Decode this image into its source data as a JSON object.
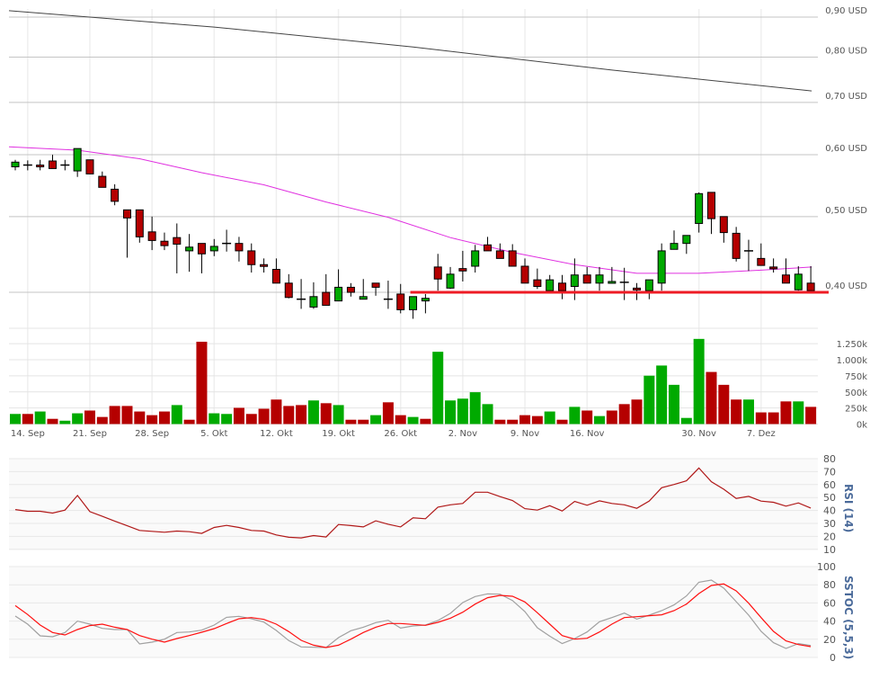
{
  "chart_data": [
    {
      "type": "candlestick",
      "panel": "price",
      "y_scale": "log",
      "ylim": [
        0.365,
        0.92
      ],
      "currency": "USD",
      "y_ticks": [
        {
          "value": 0.9,
          "label": "0,90 USD"
        },
        {
          "value": 0.8,
          "label": "0,80 USD"
        },
        {
          "value": 0.7,
          "label": "0,70 USD"
        },
        {
          "value": 0.6,
          "label": "0,60 USD"
        },
        {
          "value": 0.5,
          "label": "0,50 USD"
        },
        {
          "value": 0.4,
          "label": "0,40 USD"
        }
      ],
      "grid": true,
      "colors": {
        "up": "#00aa00",
        "down": "#b50000",
        "ma_short": "#e030e0",
        "ma_long": "#444444",
        "support": "#ee1c25"
      },
      "ohlc": [
        [
          0.579,
          0.591,
          0.573,
          0.587
        ],
        [
          0.582,
          0.59,
          0.573,
          0.582
        ],
        [
          0.582,
          0.591,
          0.573,
          0.58
        ],
        [
          0.589,
          0.6,
          0.576,
          0.576
        ],
        [
          0.582,
          0.591,
          0.573,
          0.582
        ],
        [
          0.572,
          0.611,
          0.562,
          0.611
        ],
        [
          0.591,
          0.591,
          0.567,
          0.567
        ],
        [
          0.563,
          0.571,
          0.545,
          0.545
        ],
        [
          0.542,
          0.55,
          0.517,
          0.523
        ],
        [
          0.51,
          0.51,
          0.443,
          0.498
        ],
        [
          0.51,
          0.51,
          0.463,
          0.471
        ],
        [
          0.478,
          0.5,
          0.453,
          0.466
        ],
        [
          0.465,
          0.477,
          0.453,
          0.459
        ],
        [
          0.47,
          0.49,
          0.423,
          0.461
        ],
        [
          0.452,
          0.475,
          0.425,
          0.457
        ],
        [
          0.462,
          0.462,
          0.423,
          0.448
        ],
        [
          0.452,
          0.468,
          0.445,
          0.458
        ],
        [
          0.462,
          0.481,
          0.451,
          0.462
        ],
        [
          0.462,
          0.471,
          0.438,
          0.452
        ],
        [
          0.452,
          0.462,
          0.424,
          0.434
        ],
        [
          0.434,
          0.442,
          0.424,
          0.432
        ],
        [
          0.428,
          0.442,
          0.411,
          0.411
        ],
        [
          0.411,
          0.422,
          0.393,
          0.394
        ],
        [
          0.392,
          0.416,
          0.381,
          0.391
        ],
        [
          0.383,
          0.412,
          0.381,
          0.395
        ],
        [
          0.4,
          0.422,
          0.385,
          0.385
        ],
        [
          0.39,
          0.428,
          0.39,
          0.406
        ],
        [
          0.406,
          0.411,
          0.395,
          0.4
        ],
        [
          0.392,
          0.416,
          0.392,
          0.395
        ],
        [
          0.411,
          0.411,
          0.396,
          0.406
        ],
        [
          0.392,
          0.414,
          0.381,
          0.391
        ],
        [
          0.398,
          0.41,
          0.376,
          0.38
        ],
        [
          0.38,
          0.395,
          0.37,
          0.395
        ],
        [
          0.39,
          0.398,
          0.376,
          0.393
        ],
        [
          0.431,
          0.448,
          0.402,
          0.416
        ],
        [
          0.405,
          0.431,
          0.404,
          0.422
        ],
        [
          0.429,
          0.452,
          0.413,
          0.426
        ],
        [
          0.432,
          0.46,
          0.424,
          0.452
        ],
        [
          0.46,
          0.471,
          0.452,
          0.452
        ],
        [
          0.452,
          0.462,
          0.442,
          0.442
        ],
        [
          0.452,
          0.461,
          0.432,
          0.432
        ],
        [
          0.432,
          0.442,
          0.411,
          0.411
        ],
        [
          0.415,
          0.429,
          0.404,
          0.407
        ],
        [
          0.402,
          0.421,
          0.402,
          0.415
        ],
        [
          0.411,
          0.421,
          0.392,
          0.402
        ],
        [
          0.407,
          0.442,
          0.391,
          0.421
        ],
        [
          0.421,
          0.431,
          0.411,
          0.411
        ],
        [
          0.411,
          0.431,
          0.402,
          0.421
        ],
        [
          0.411,
          0.431,
          0.411,
          0.413
        ],
        [
          0.412,
          0.43,
          0.391,
          0.412
        ],
        [
          0.405,
          0.411,
          0.391,
          0.403
        ],
        [
          0.402,
          0.415,
          0.392,
          0.415
        ],
        [
          0.411,
          0.462,
          0.402,
          0.452
        ],
        [
          0.454,
          0.48,
          0.454,
          0.462
        ],
        [
          0.462,
          0.473,
          0.448,
          0.473
        ],
        [
          0.49,
          0.537,
          0.477,
          0.535
        ],
        [
          0.537,
          0.537,
          0.475,
          0.497
        ],
        [
          0.5,
          0.5,
          0.463,
          0.477
        ],
        [
          0.476,
          0.485,
          0.438,
          0.442
        ],
        [
          0.452,
          0.467,
          0.426,
          0.452
        ],
        [
          0.442,
          0.462,
          0.433,
          0.433
        ],
        [
          0.431,
          0.442,
          0.424,
          0.429
        ],
        [
          0.421,
          0.442,
          0.411,
          0.411
        ],
        [
          0.403,
          0.432,
          0.402,
          0.422
        ],
        [
          0.411,
          0.432,
          0.402,
          0.402
        ]
      ],
      "ma_short": [
        [
          0,
          0.614
        ],
        [
          5,
          0.608
        ],
        [
          10,
          0.593
        ],
        [
          15,
          0.569
        ],
        [
          20,
          0.549
        ],
        [
          25,
          0.522
        ],
        [
          30,
          0.499
        ],
        [
          35,
          0.47
        ],
        [
          40,
          0.45
        ],
        [
          45,
          0.434
        ],
        [
          50,
          0.423
        ],
        [
          55,
          0.423
        ],
        [
          60,
          0.427
        ],
        [
          64,
          0.431
        ]
      ],
      "ma_long": [
        [
          0,
          0.917
        ],
        [
          16,
          0.874
        ],
        [
          32,
          0.824
        ],
        [
          48,
          0.77
        ],
        [
          64,
          0.724
        ]
      ],
      "support_level": {
        "value": 0.4,
        "from_bar": 32,
        "to_bar": 65
      }
    },
    {
      "type": "bar",
      "panel": "volume",
      "ylim": [
        0,
        1350000
      ],
      "y_ticks": [
        {
          "value": 1250000,
          "label": "1.250k"
        },
        {
          "value": 1000000,
          "label": "1.000k"
        },
        {
          "value": 750000,
          "label": "750k"
        },
        {
          "value": 500000,
          "label": "500k"
        },
        {
          "value": 250000,
          "label": "250k"
        },
        {
          "value": 0,
          "label": "0k"
        }
      ],
      "values": [
        157000,
        157000,
        195000,
        81000,
        52000,
        167000,
        210000,
        110000,
        281000,
        281000,
        195000,
        138000,
        195000,
        295000,
        67000,
        1280000,
        167000,
        157000,
        252000,
        157000,
        238000,
        381000,
        281000,
        295000,
        367000,
        324000,
        295000,
        67000,
        67000,
        138000,
        338000,
        138000,
        110000,
        81000,
        1124000,
        367000,
        395000,
        495000,
        310000,
        67000,
        67000,
        138000,
        124000,
        195000,
        67000,
        267000,
        210000,
        124000,
        210000,
        310000,
        381000,
        752000,
        910000,
        610000,
        95000,
        1324000,
        810000,
        610000,
        381000,
        381000,
        181000,
        181000,
        352000,
        352000,
        267000
      ],
      "colors": [
        "g",
        "r",
        "g",
        "r",
        "g",
        "g",
        "r",
        "r",
        "r",
        "r",
        "r",
        "r",
        "r",
        "g",
        "r",
        "r",
        "g",
        "g",
        "r",
        "r",
        "r",
        "r",
        "r",
        "r",
        "g",
        "r",
        "g",
        "r",
        "r",
        "g",
        "r",
        "r",
        "g",
        "r",
        "g",
        "g",
        "g",
        "g",
        "g",
        "r",
        "r",
        "r",
        "r",
        "g",
        "r",
        "g",
        "r",
        "g",
        "r",
        "r",
        "r",
        "g",
        "g",
        "g",
        "g",
        "g",
        "r",
        "r",
        "r",
        "g",
        "r",
        "r",
        "r",
        "g",
        "r"
      ]
    },
    {
      "type": "line",
      "panel": "rsi",
      "title": "RSI (14)",
      "ylim": [
        5,
        82
      ],
      "y_ticks": [
        80,
        70,
        60,
        50,
        40,
        30,
        20,
        10
      ],
      "color": "#b01818",
      "values": [
        40.7,
        39.4,
        39.4,
        38.0,
        40.3,
        51.6,
        39.1,
        35.5,
        31.8,
        28.2,
        24.6,
        23.9,
        23.2,
        24.1,
        23.6,
        22.3,
        26.9,
        28.5,
        26.9,
        24.6,
        24.1,
        21.1,
        19.3,
        18.8,
        20.6,
        19.5,
        29.2,
        28.3,
        27.3,
        32.0,
        29.4,
        27.3,
        34.3,
        33.6,
        42.6,
        44.4,
        45.4,
        54.1,
        54.1,
        50.7,
        47.7,
        41.4,
        40.3,
        43.7,
        39.6,
        47.0,
        44.0,
        47.4,
        45.4,
        44.4,
        41.7,
        47.2,
        57.6,
        60.1,
        62.9,
        72.8,
        62.2,
        56.4,
        49.3,
        50.9,
        47.2,
        46.3,
        43.3,
        45.8,
        41.9
      ]
    },
    {
      "type": "line",
      "panel": "sstoc",
      "title": "SSTOC (5,5,3)",
      "ylim": [
        0,
        100
      ],
      "y_ticks": [
        100,
        80,
        60,
        40,
        20,
        0
      ],
      "series": [
        {
          "color": "#a0a0a0",
          "values": [
            45.5,
            36.6,
            23.8,
            22.8,
            27.4,
            40.0,
            36.6,
            32.0,
            30.7,
            30.7,
            14.9,
            16.8,
            20.1,
            27.4,
            28.0,
            30.0,
            35.6,
            44.2,
            45.2,
            42.6,
            38.9,
            29.7,
            18.5,
            11.6,
            11.2,
            10.9,
            21.8,
            29.4,
            33.3,
            38.3,
            40.9,
            32.3,
            34.7,
            35.6,
            40.6,
            48.5,
            60.4,
            67.0,
            70.0,
            69.6,
            62.7,
            50.5,
            32.7,
            23.4,
            15.2,
            20.8,
            28.0,
            39.3,
            43.9,
            48.8,
            42.2,
            46.5,
            51.5,
            57.8,
            67.7,
            82.8,
            85.1,
            76.2,
            61.4,
            46.5,
            28.7,
            16.2,
            9.9,
            15.2,
            13.2
          ]
        },
        {
          "color": "#ff1010",
          "values": [
            57.0,
            47.2,
            35.6,
            27.4,
            24.8,
            30.7,
            35.0,
            36.6,
            33.3,
            30.7,
            24.1,
            20.1,
            16.8,
            20.8,
            24.1,
            27.7,
            31.7,
            37.3,
            42.6,
            43.9,
            41.9,
            36.6,
            28.4,
            18.8,
            13.5,
            10.9,
            13.5,
            20.1,
            27.4,
            33.3,
            37.3,
            37.3,
            36.3,
            35.3,
            38.6,
            43.2,
            49.8,
            58.7,
            65.7,
            68.3,
            67.3,
            61.1,
            49.2,
            36.6,
            24.1,
            20.1,
            21.1,
            28.0,
            36.6,
            43.9,
            44.9,
            45.9,
            46.9,
            51.5,
            58.7,
            70.3,
            79.2,
            80.9,
            73.3,
            59.7,
            43.9,
            28.7,
            18.2,
            14.2,
            11.9
          ]
        }
      ]
    }
  ],
  "x_labels": [
    {
      "bar": 1,
      "label": "14. Sep"
    },
    {
      "bar": 6,
      "label": "21. Sep"
    },
    {
      "bar": 11,
      "label": "28. Sep"
    },
    {
      "bar": 16,
      "label": "5. Okt"
    },
    {
      "bar": 21,
      "label": "12. Okt"
    },
    {
      "bar": 26,
      "label": "19. Okt"
    },
    {
      "bar": 31,
      "label": "26. Okt"
    },
    {
      "bar": 36,
      "label": "2. Nov"
    },
    {
      "bar": 41,
      "label": "9. Nov"
    },
    {
      "bar": 46,
      "label": "16. Nov"
    },
    {
      "bar": 55,
      "label": "30. Nov"
    },
    {
      "bar": 60,
      "label": "7. Dez"
    }
  ]
}
